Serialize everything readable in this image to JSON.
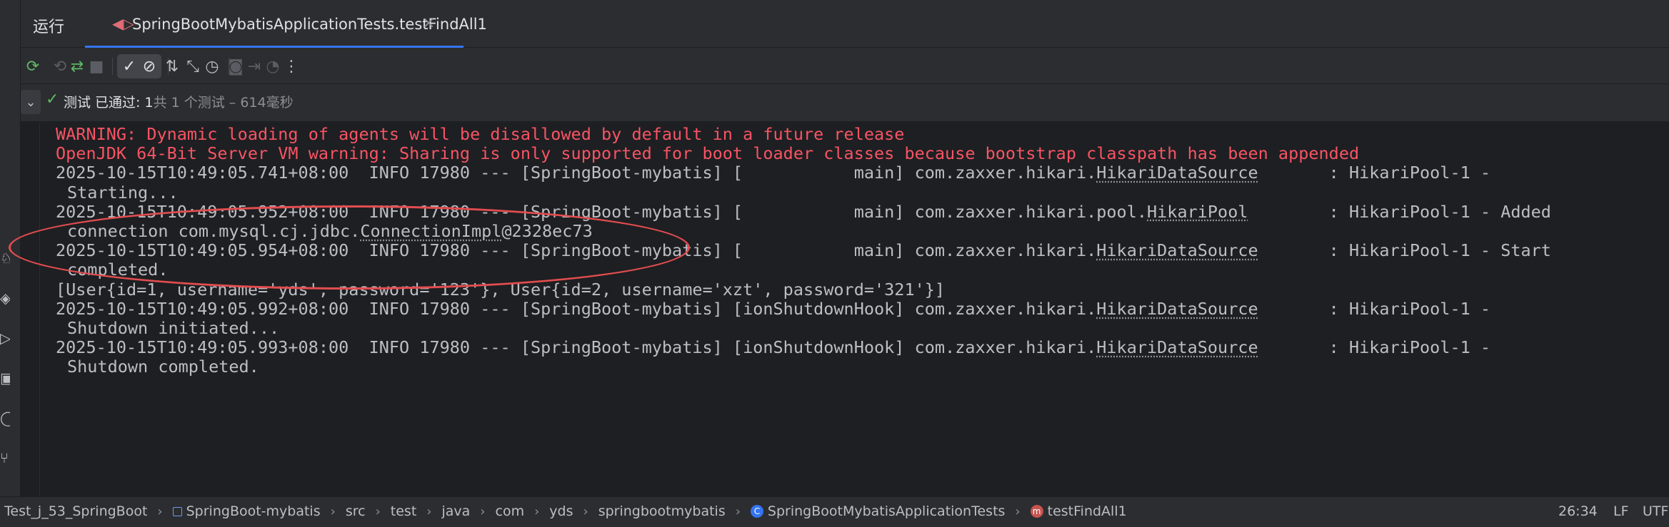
{
  "run_panel": {
    "title": "运行",
    "tab": {
      "icon": "test-run-icon",
      "label": "SpringBootMybatisApplicationTests.testFindAll1",
      "close": "×"
    }
  },
  "toolbar": {
    "buttons": [
      {
        "name": "rerun-icon",
        "glyph": "⟳"
      },
      {
        "name": "rerun-failed-icon",
        "glyph": "⟲"
      },
      {
        "name": "toggle-auto-test-icon",
        "glyph": "⇄"
      },
      {
        "name": "stop-icon",
        "glyph": "■"
      },
      {
        "name": "show-passed-icon",
        "glyph": "✓"
      },
      {
        "name": "show-ignored-icon",
        "glyph": "⊘"
      },
      {
        "name": "sort-alphabetically-icon",
        "glyph": "⇅"
      },
      {
        "name": "collapse-all-icon",
        "glyph": "⤡"
      },
      {
        "name": "test-history-icon",
        "glyph": "◷"
      },
      {
        "name": "screenshot-icon",
        "glyph": "◙"
      },
      {
        "name": "export-icon",
        "glyph": "⇥"
      },
      {
        "name": "import-tests-icon",
        "glyph": "◔"
      },
      {
        "name": "more-options-icon",
        "glyph": "⋮"
      }
    ]
  },
  "status": {
    "check": "✓",
    "text_main": "测试 已通过: 1",
    "text_detail": "共 1 个测试 – 614毫秒"
  },
  "console": {
    "warning1": "WARNING: Dynamic loading of agents will be disallowed by default in a future release",
    "warning2": "OpenJDK 64-Bit Server VM warning: Sharing is only supported for boot loader classes because bootstrap classpath has been appended",
    "log1_pre": "2025-10-15T10:49:05.741+08:00  INFO 17980 --- [SpringBoot-mybatis] [           main] com.zaxxer.hikari.",
    "log1_cls": "HikariDataSource",
    "log1_post": "       : HikariPool-1 -",
    "log1_cont": "Starting...",
    "log2_pre": "2025-10-15T10:49:05.952+08:00  INFO 17980 --- [SpringBoot-mybatis] [           main] com.zaxxer.hikari.pool.",
    "log2_cls": "HikariPool",
    "log2_post": "        : HikariPool-1 - Added",
    "log2_cont_pre": "connection com.mysql.cj.jdbc.",
    "log2_cont_cls": "ConnectionImpl",
    "log2_cont_post": "@2328ec73",
    "log3_pre": "2025-10-15T10:49:05.954+08:00  INFO 17980 --- [SpringBoot-mybatis] [           main] com.zaxxer.hikari.",
    "log3_cls": "HikariDataSource",
    "log3_post": "       : HikariPool-1 - Start",
    "log3_cont": "completed.",
    "result": "[User{id=1, username='yds', password='123'}, User{id=2, username='xzt', password='321'}]",
    "log4_pre": "2025-10-15T10:49:05.992+08:00  INFO 17980 --- [SpringBoot-mybatis] [ionShutdownHook] com.zaxxer.hikari.",
    "log4_cls": "HikariDataSource",
    "log4_post": "       : HikariPool-1 -",
    "log4_cont": "Shutdown initiated...",
    "log5_pre": "2025-10-15T10:49:05.993+08:00  INFO 17980 --- [SpringBoot-mybatis] [ionShutdownHook] com.zaxxer.hikari.",
    "log5_cls": "HikariDataSource",
    "log5_post": "       : HikariPool-1 -",
    "log5_cont": "Shutdown completed."
  },
  "breadcrumb": {
    "items": [
      "Test_j_53_SpringBoot",
      "SpringBoot-mybatis",
      "src",
      "test",
      "java",
      "com",
      "yds",
      "springbootmybatis",
      "SpringBootMybatisApplicationTests",
      "testFindAll1"
    ],
    "separator": "›"
  },
  "statusbar": {
    "position": "26:34",
    "line_ending": "LF",
    "encoding": "UTF-"
  },
  "colors": {
    "warning_text": "#f75464",
    "passed_green": "#5fb865",
    "annotation_ellipse": "#e24d4f",
    "tab_underline": "#3574f0"
  }
}
